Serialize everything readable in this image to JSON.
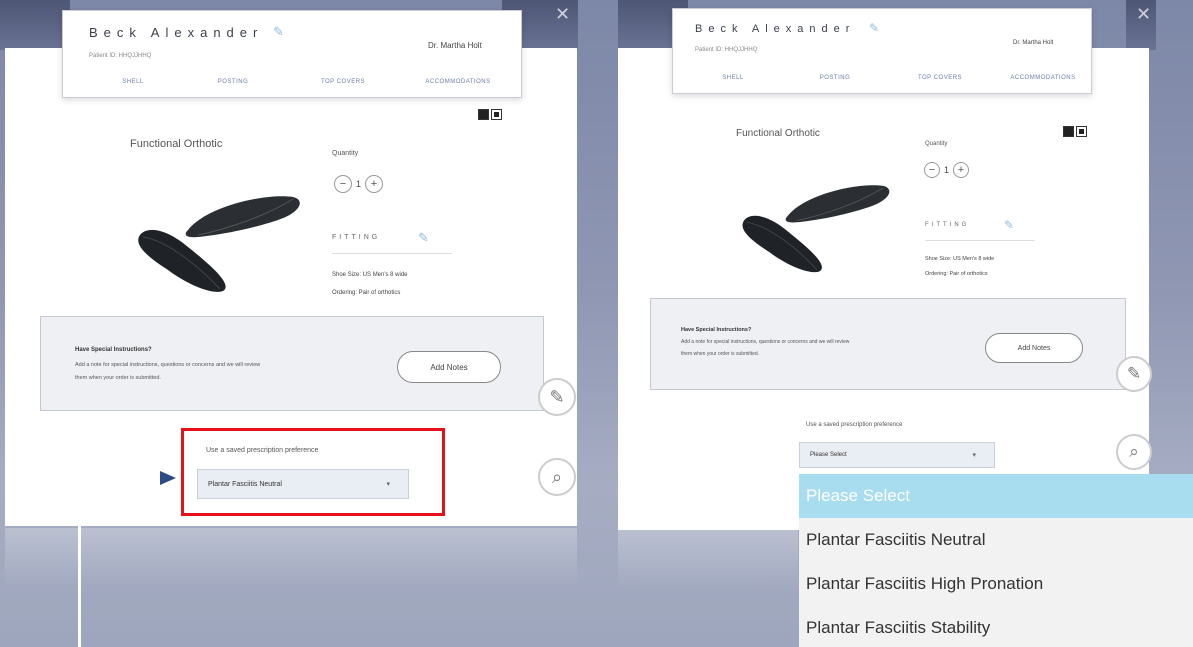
{
  "left": {
    "patient_name": "Beck Alexander",
    "patient_id": "Patient ID: HHQJJHHQ",
    "doctor": "Dr. Martha Holt",
    "tabs": [
      "SHELL",
      "POSTING",
      "TOP COVERS",
      "ACCOMMODATIONS"
    ],
    "product_title": "Functional Orthotic",
    "quantity_label": "Quantity",
    "quantity_value": "1",
    "fitting_label": "FITTING",
    "shoe_size": "Shoe Size: US Men's 8 wide",
    "ordering": "Ordering: Pair of orthotics",
    "notes_title": "Have Special Instructions?",
    "notes_desc_1": "Add a note for special instructions, questions or concerns and we will review",
    "notes_desc_2": "them when your order is submitted.",
    "add_notes": "Add Notes",
    "pref_label": "Use a saved prescription preference",
    "pref_value": "Plantar Fasciitis Neutral"
  },
  "right": {
    "patient_name": "Beck Alexander",
    "patient_id": "Patient ID: HHQJJHHQ",
    "doctor": "Dr. Martha Holt",
    "tabs": [
      "SHELL",
      "POSTING",
      "TOP COVERS",
      "ACCOMMODATIONS"
    ],
    "product_title": "Functional Orthotic",
    "quantity_label": "Quantity",
    "quantity_value": "1",
    "fitting_label": "FITTING",
    "shoe_size": "Shoe Size: US Men's 8 wide",
    "ordering": "Ordering: Pair of orthotics",
    "notes_title": "Have Special Instructions?",
    "notes_desc_1": "Add a note for special instructions, questions or concerns and we will review",
    "notes_desc_2": "them when your order is submitted.",
    "add_notes": "Add Notes",
    "pref_label": "Use a saved prescription preference",
    "pref_value": "Please Select"
  },
  "dropdown": {
    "options": [
      "Please Select",
      "Plantar Fasciitis Neutral",
      "Plantar Fasciitis High Pronation",
      "Plantar Fasciitis Stability"
    ],
    "selected_index": 0
  },
  "icons": {
    "edit": "pencil-icon",
    "notes_side": "notes-icon",
    "search_side": "search-icon",
    "close": "close-icon",
    "view_toggle": "view-toggle-icon"
  },
  "colors": {
    "highlight": "#e8101a",
    "dropdown_selected": "#a8dcef",
    "tab_text": "#6b7cab"
  }
}
